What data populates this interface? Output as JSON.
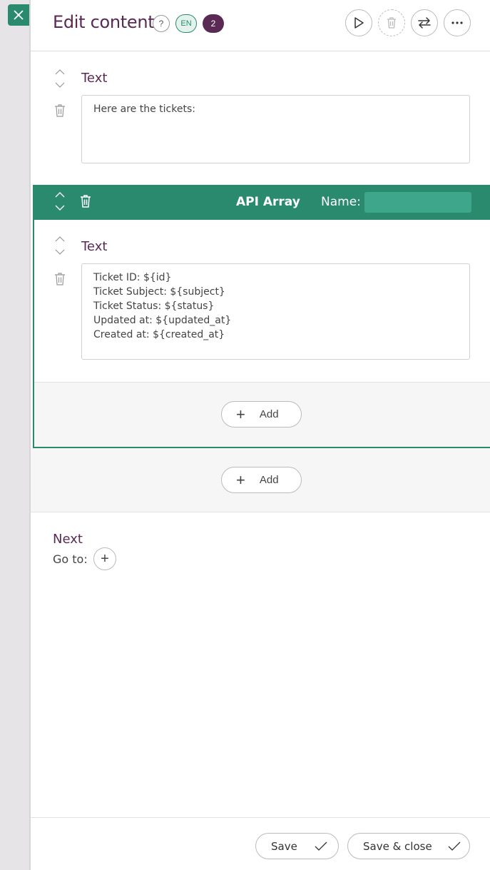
{
  "header": {
    "title": "Edit content",
    "help_label": "?",
    "language": "EN",
    "count": "2"
  },
  "blocks": [
    {
      "label": "Text",
      "content": "Here are the tickets:"
    }
  ],
  "api_array": {
    "title": "API Array",
    "name_label": "Name:",
    "name_value": "",
    "blocks": [
      {
        "label": "Text",
        "content": "Ticket ID: ${id}\nTicket Subject: ${subject}\nTicket Status: ${status}\nUpdated at: ${updated_at}\nCreated at: ${created_at}"
      }
    ],
    "add_label": "Add"
  },
  "outer_add_label": "Add",
  "next": {
    "title": "Next",
    "goto_label": "Go to:"
  },
  "footer": {
    "save_label": "Save",
    "save_close_label": "Save & close"
  },
  "colors": {
    "accent": "#2a8a6e",
    "brand": "#5a2a55"
  }
}
